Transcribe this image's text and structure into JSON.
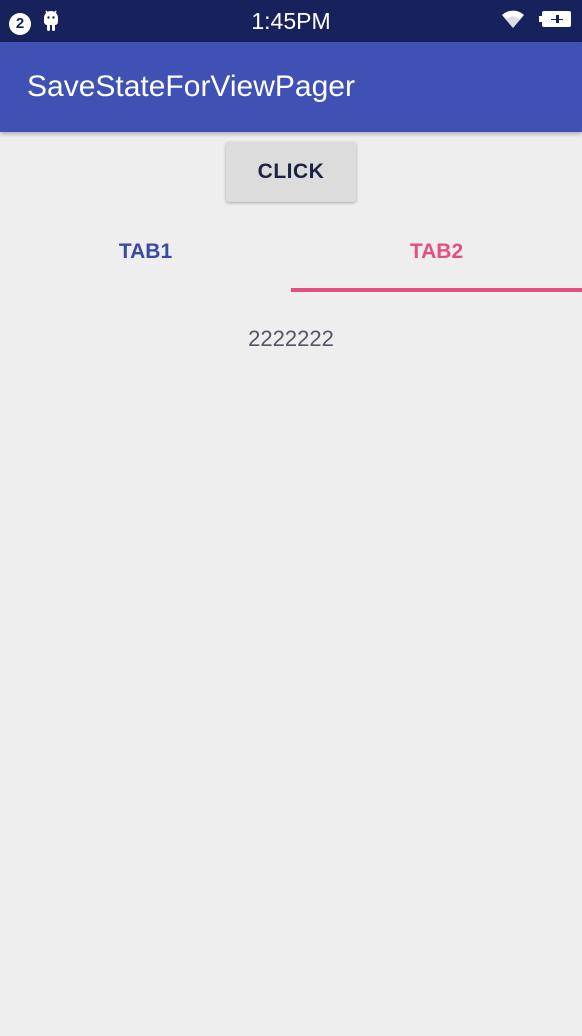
{
  "status_bar": {
    "notification_count": "2",
    "time": "1:45PM",
    "icons": [
      "notification-count-icon",
      "android-icon",
      "wifi-icon",
      "battery-charging-icon"
    ]
  },
  "app_bar": {
    "title": "SaveStateForViewPager"
  },
  "button": {
    "label": "CLICK"
  },
  "tabs": [
    {
      "label": "TAB1",
      "selected": false
    },
    {
      "label": "TAB2",
      "selected": true
    }
  ],
  "page": {
    "text": "2222222"
  },
  "colors": {
    "status_bar": "#17215c",
    "app_bar": "#3f51b5",
    "accent": "#e44f7f",
    "tab_text": "#3a4a9f",
    "background": "#efeeee"
  }
}
